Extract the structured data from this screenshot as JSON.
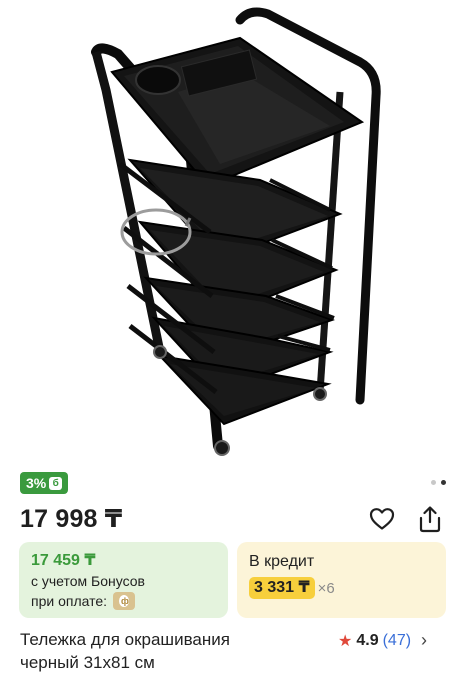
{
  "product": {
    "bonus_badge": "3%",
    "bonus_badge_icon": "б",
    "price": "17 998 ₸",
    "title_line1": "Тележка для окрашивания",
    "title_line2": "черный 31х81 см"
  },
  "bonus_offer": {
    "price": "17 459 ₸",
    "line1": "с учетом Бонусов",
    "line2": "при оплате:",
    "coin_icon": "ф"
  },
  "credit": {
    "title": "В кредит",
    "amount": "3 331 ₸",
    "multiplier": "×6"
  },
  "rating": {
    "score": "4.9",
    "count": "(47)"
  },
  "image_pager": {
    "total": 2,
    "active": 2
  },
  "colors": {
    "bonus_green": "#3a9a3e",
    "bonus_card_bg": "#e4f3dd",
    "credit_card_bg": "#fcf4d8",
    "credit_highlight": "#f7cf3c",
    "rating_star": "#e0483a",
    "rating_link": "#3a6fd8"
  },
  "icons": [
    "heart-icon",
    "share-icon",
    "star-icon",
    "chevron-right-icon"
  ]
}
